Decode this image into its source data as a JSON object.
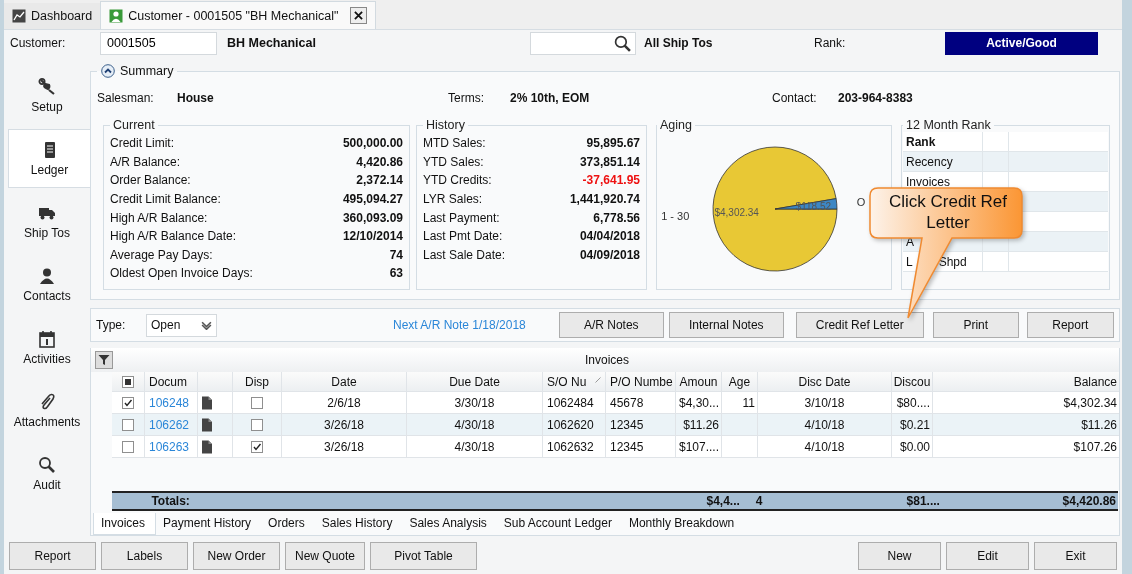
{
  "tabs": [
    {
      "kind": "dashboard",
      "label": "Dashboard",
      "selected": false,
      "closable": false
    },
    {
      "kind": "record",
      "label": "Customer - 0001505 \"BH Mechanical\"",
      "selected": true,
      "closable": true
    }
  ],
  "header": {
    "customer_label": "Customer:",
    "customer_value": "0001505",
    "customer_name": "BH Mechanical",
    "ship_to": "All Ship Tos",
    "rank_label": "Rank:",
    "rank_status": "Active/Good"
  },
  "sidebar": {
    "items": [
      {
        "label": "Setup",
        "selected": false
      },
      {
        "label": "Ledger",
        "selected": true
      },
      {
        "label": "Ship Tos",
        "selected": false
      },
      {
        "label": "Contacts",
        "selected": false
      },
      {
        "label": "Activities",
        "selected": false
      },
      {
        "label": "Attachments",
        "selected": false
      },
      {
        "label": "Audit",
        "selected": false
      }
    ]
  },
  "summary": {
    "title": "Summary",
    "expanded": true,
    "info": [
      {
        "label": "Salesman:",
        "value": "House"
      },
      {
        "label": "Terms:",
        "value": "2% 10th, EOM"
      },
      {
        "label": "Contact:",
        "value": "203-964-8383"
      }
    ],
    "current": {
      "title": "Current",
      "rows": [
        {
          "label": "Credit Limit:",
          "value": "500,000.00",
          "negative": false
        },
        {
          "label": "A/R Balance:",
          "value": "4,420.86",
          "negative": false
        },
        {
          "label": "Order Balance:",
          "value": "2,372.14",
          "negative": false
        },
        {
          "label": "Credit Limit Balance:",
          "value": "495,094.27",
          "negative": false
        },
        {
          "label": "High A/R Balance:",
          "value": "360,093.09",
          "negative": false
        },
        {
          "label": "High A/R Balance Date:",
          "value": "12/10/2014",
          "negative": false
        },
        {
          "label": "Average Pay Days:",
          "value": "74",
          "negative": false
        },
        {
          "label": "Oldest Open Invoice Days:",
          "value": "63",
          "negative": false
        }
      ]
    },
    "history": {
      "title": "History",
      "rows": [
        {
          "label": "MTD Sales:",
          "value": "95,895.67",
          "negative": false
        },
        {
          "label": "YTD Sales:",
          "value": "373,851.14",
          "negative": false
        },
        {
          "label": "YTD Credits:",
          "value": "-37,641.95",
          "negative": true
        },
        {
          "label": "LYR Sales:",
          "value": "1,441,920.74",
          "negative": false
        },
        {
          "label": "Last Payment:",
          "value": "6,778.56",
          "negative": false
        },
        {
          "label": "Last Pmt Date:",
          "value": "04/04/2018",
          "negative": false
        },
        {
          "label": "Last Sale Date:",
          "value": "04/09/2018",
          "negative": false
        }
      ]
    },
    "aging": {
      "title": "Aging",
      "chart_data": {
        "type": "pie",
        "categories": [
          "1 - 30",
          "O"
        ],
        "values": [
          4302.34,
          118.52
        ],
        "value_labels": [
          "$4,302.34",
          "$118.52"
        ]
      }
    },
    "rank": {
      "title": "12 Month Rank",
      "rows": [
        {
          "kind": "header",
          "parts": [
            "Rank"
          ]
        },
        {
          "kind": "row",
          "parts": [
            "Recency"
          ]
        },
        {
          "kind": "row",
          "parts": [
            "Invoices"
          ]
        },
        {
          "kind": "row",
          "parts": []
        },
        {
          "kind": "row",
          "parts": []
        },
        {
          "kind": "row",
          "parts": [
            "A"
          ]
        },
        {
          "kind": "row",
          "parts": [
            "L",
            "Shpd"
          ]
        }
      ]
    }
  },
  "toolbar": {
    "type_label": "Type:",
    "type_value": "Open",
    "next_note": "Next A/R Note 1/18/2018",
    "buttons": [
      "A/R Notes",
      "Internal Notes",
      "Credit Ref Letter",
      "Print",
      "Report"
    ]
  },
  "invoices": {
    "title": "Invoices",
    "select_all": {
      "indeterminate": true
    },
    "columns": [
      "Docum",
      "Disp",
      "Date",
      "Due Date",
      "S/O Nu",
      "P/O Numbe",
      "Amoun",
      "Age",
      "Disc Date",
      "Discou",
      "Balance"
    ],
    "rows": [
      {
        "checked": true,
        "document": "106248",
        "disp": false,
        "date": "2/6/18",
        "due_date": "3/30/18",
        "so_number": "1062484",
        "po_number": "45678",
        "amount": "$4,30...",
        "age": "11",
        "disc_date": "3/10/18",
        "discount": "$80....",
        "balance": "$4,302.34"
      },
      {
        "checked": false,
        "document": "106262",
        "disp": false,
        "date": "3/26/18",
        "due_date": "4/30/18",
        "so_number": "1062620",
        "po_number": "12345",
        "amount": "$11.26",
        "disc_date": "4/10/18",
        "discount": "$0.21",
        "balance": "$11.26"
      },
      {
        "checked": false,
        "document": "106263",
        "disp": true,
        "date": "3/26/18",
        "due_date": "4/30/18",
        "so_number": "1062632",
        "po_number": "12345",
        "amount": "$107....",
        "disc_date": "4/10/18",
        "discount": "$0.00",
        "balance": "$107.26"
      }
    ],
    "totals": {
      "label": "Totals:",
      "amount": "$4,4...",
      "age": "4",
      "discount": "$81....",
      "balance": "$4,420.86"
    }
  },
  "bottom_tabs": [
    {
      "label": "Invoices",
      "selected": true
    },
    {
      "label": "Payment History",
      "selected": false
    },
    {
      "label": "Orders",
      "selected": false
    },
    {
      "label": "Sales History",
      "selected": false
    },
    {
      "label": "Sales Analysis",
      "selected": false
    },
    {
      "label": "Sub Account Ledger",
      "selected": false
    },
    {
      "label": "Monthly Breakdown",
      "selected": false
    }
  ],
  "footer": {
    "left_buttons": [
      "Report",
      "Labels",
      "New Order",
      "New Quote",
      "Pivot Table"
    ],
    "right_buttons": [
      "New",
      "Edit",
      "Exit"
    ]
  },
  "callout": {
    "text": "Click Credit Ref Letter"
  }
}
